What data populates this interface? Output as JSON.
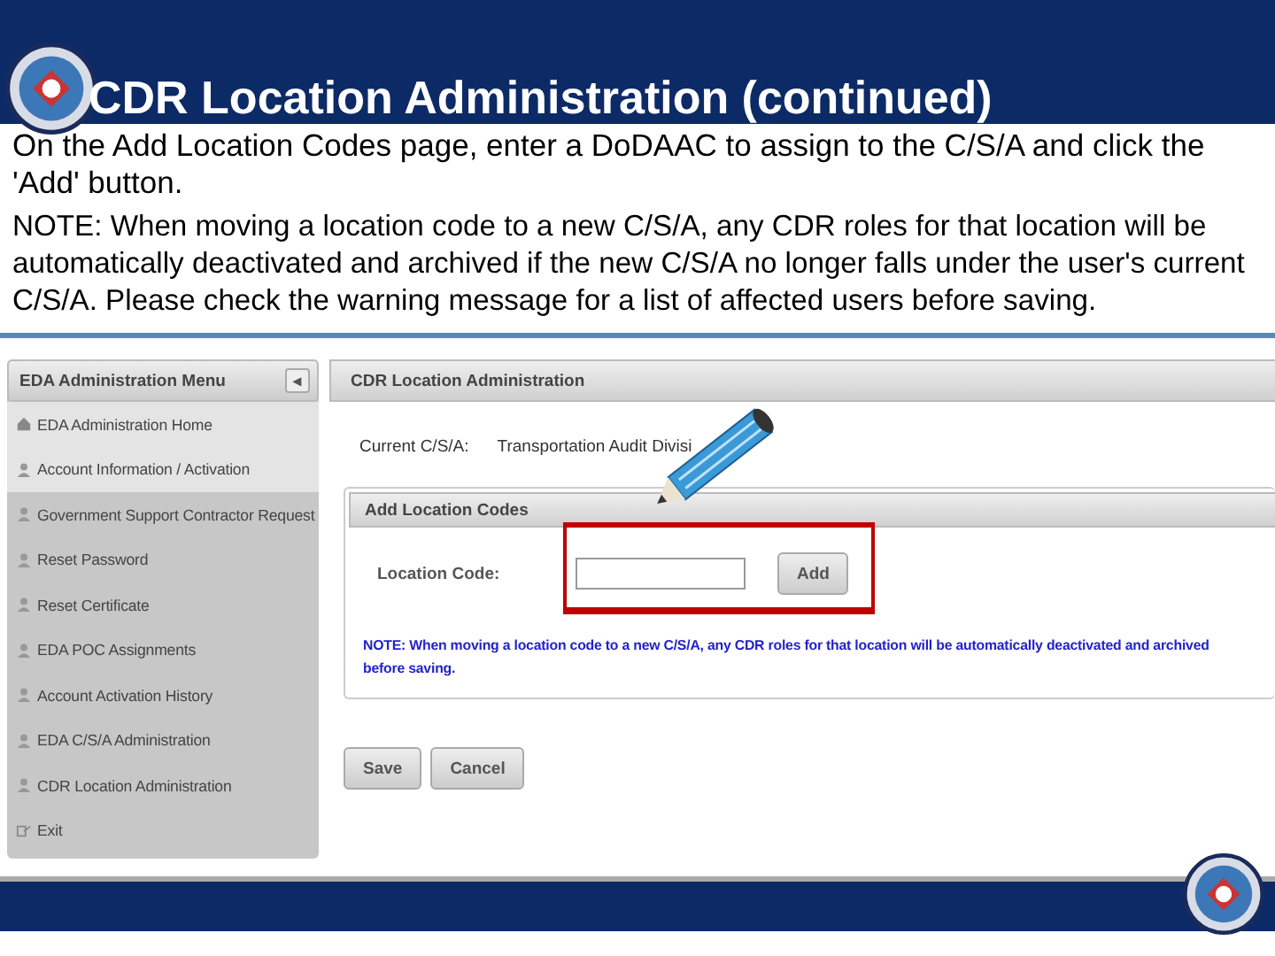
{
  "slide": {
    "title": "CDR Location Administration (continued)",
    "paragraphs": [
      "On the Add Location Codes page, enter a DoDAAC to assign to the C/S/A and click the 'Add' button.",
      "NOTE: When moving a location code to a new C/S/A, any CDR roles for that location will be automatically deactivated and archived if the new C/S/A no longer falls under the user's current C/S/A. Please check the warning message for a list of affected users before saving."
    ]
  },
  "menu": {
    "title": "EDA Administration Menu",
    "collapse_icon": "◂",
    "items": [
      {
        "label": "EDA Administration Home",
        "kind": "home",
        "highlighted": true
      },
      {
        "label": "Account Information / Activation",
        "kind": "user",
        "highlighted": true
      },
      {
        "label": "Government Support Contractor Request",
        "kind": "user",
        "highlighted": false
      },
      {
        "label": "Reset Password",
        "kind": "user",
        "highlighted": false
      },
      {
        "label": "Reset Certificate",
        "kind": "user",
        "highlighted": false
      },
      {
        "label": "EDA POC Assignments",
        "kind": "user",
        "highlighted": false
      },
      {
        "label": "Account Activation History",
        "kind": "user",
        "highlighted": false
      },
      {
        "label": "EDA C/S/A Administration",
        "kind": "user",
        "highlighted": false
      },
      {
        "label": "CDR Location Administration",
        "kind": "user",
        "highlighted": false
      },
      {
        "label": "Exit",
        "kind": "exit",
        "highlighted": false
      }
    ]
  },
  "panel": {
    "title": "CDR Location Administration",
    "current_label": "Current C/S/A:",
    "current_value": "Transportation Audit Divisi",
    "section_title": "Add Location Codes",
    "field_label": "Location Code:",
    "add_button": "Add",
    "note": [
      "NOTE: When moving a location code to a new C/S/A, any CDR roles for that location will be automatically deactivated and archived",
      "before saving."
    ],
    "buttons": [
      "Save",
      "Cancel"
    ]
  }
}
